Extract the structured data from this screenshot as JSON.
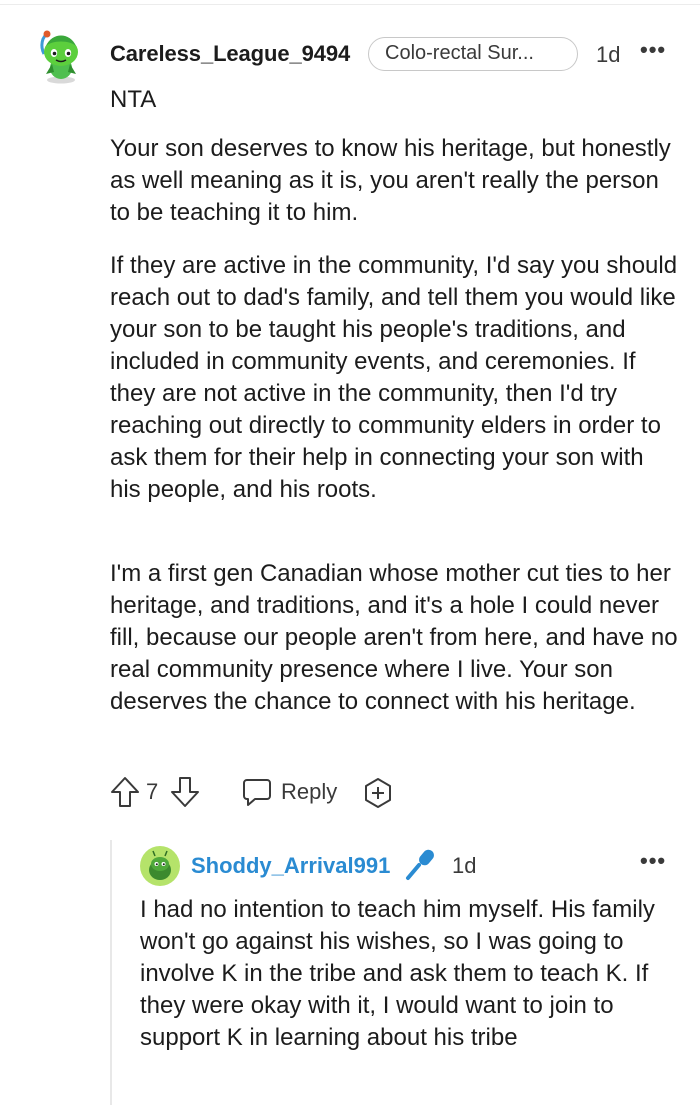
{
  "comment": {
    "username": "Careless_League_9494",
    "flair": "Colo-rectal Sur...",
    "time": "1d",
    "more": "•••",
    "paragraphs": [
      "NTA",
      "Your son deserves to know his heritage, but honestly as well meaning as it is, you aren't really the person to be teaching it to him.",
      "If they are active in the community, I'd say you should reach out to dad's family, and tell them you would like your son to be taught his people's traditions, and included in community events, and ceremonies. If they are not active in the community, then I'd try reaching out directly to community elders in order to ask them for their help in connecting your son with his people, and his roots.",
      "I'm a first gen Canadian whose mother cut ties to her heritage, and traditions, and it's a hole I could never fill, because our people aren't from here, and have no real community presence where I live. Your son deserves the chance to connect with his heritage."
    ],
    "votes": "7",
    "reply_label": "Reply",
    "colors": {
      "username": "#1c1c1c",
      "text": "#1c1c1c",
      "meta": "#3a3a3a"
    }
  },
  "reply": {
    "username": "Shoddy_Arrival991",
    "time": "1d",
    "more": "•••",
    "text": "I had no intention to teach him myself. His family won't go against his wishes, so I was going to involve K in the tribe and ask them to teach K. If they were okay with it, I would want to join to support K in learning about his tribe",
    "colors": {
      "username": "#2a8bd2",
      "op_badge": "#2a8bd2"
    }
  },
  "icons": [
    "snoo-avatar-icon",
    "more-options-icon",
    "upvote-arrow-icon",
    "downvote-arrow-icon",
    "reply-bubble-icon",
    "award-add-icon",
    "microphone-op-icon"
  ]
}
